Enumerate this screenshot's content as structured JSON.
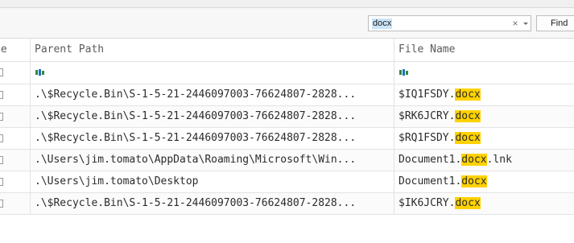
{
  "search": {
    "value": "docx",
    "clear_glyph": "×",
    "dropdown_icon": "chevron-down-icon",
    "find_label": "Find"
  },
  "columns": {
    "first_partial": "se",
    "parent_path": "Parent Path",
    "file_name": "File Name"
  },
  "filter_icon": "abc-filter-icon",
  "rows": [
    {
      "parent_path": ".\\$Recycle.Bin\\S-1-5-21-2446097003-76624807-2828...",
      "file_prefix": "$IQ1FSDY.",
      "file_match": "docx",
      "file_suffix": ""
    },
    {
      "parent_path": ".\\$Recycle.Bin\\S-1-5-21-2446097003-76624807-2828...",
      "file_prefix": "$RK6JCRY.",
      "file_match": "docx",
      "file_suffix": ""
    },
    {
      "parent_path": ".\\$Recycle.Bin\\S-1-5-21-2446097003-76624807-2828...",
      "file_prefix": "$RQ1FSDY.",
      "file_match": "docx",
      "file_suffix": ""
    },
    {
      "parent_path": ".\\Users\\jim.tomato\\AppData\\Roaming\\Microsoft\\Win...",
      "file_prefix": "Document1.",
      "file_match": "docx",
      "file_suffix": ".lnk"
    },
    {
      "parent_path": ".\\Users\\jim.tomato\\Desktop",
      "file_prefix": "Document1.",
      "file_match": "docx",
      "file_suffix": ""
    },
    {
      "parent_path": ".\\$Recycle.Bin\\S-1-5-21-2446097003-76624807-2828...",
      "file_prefix": "$IK6JCRY.",
      "file_match": "docx",
      "file_suffix": ""
    }
  ],
  "colors": {
    "highlight": "#ffd200",
    "selection": "#cce4f7"
  }
}
